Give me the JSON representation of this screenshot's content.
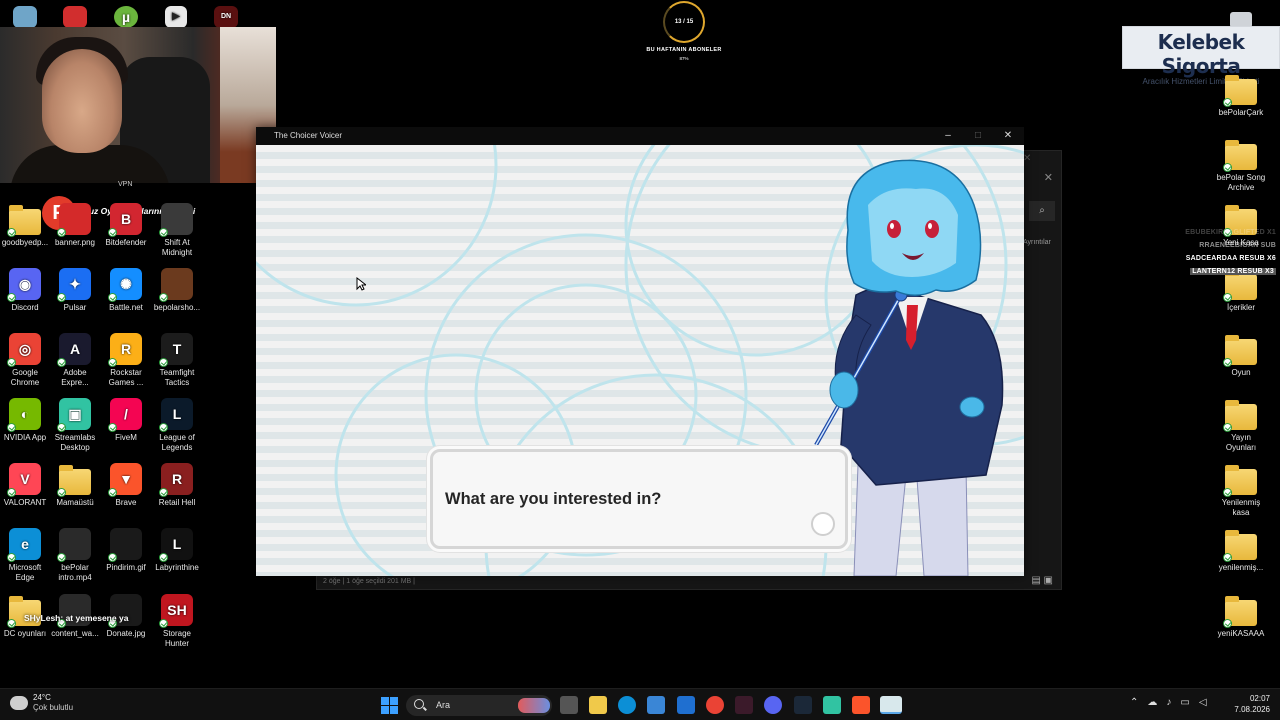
{
  "desktop": {
    "icons": [
      {
        "label": "goodbyedp...",
        "color": "#f0c94a",
        "folder": true
      },
      {
        "label": "banner.png",
        "color": "#d42a2a"
      },
      {
        "label": "Bitdefender",
        "color": "#d22630",
        "glyph": "B"
      },
      {
        "label": "Shift At Midnight",
        "color": "#3a3a3a"
      },
      {
        "label": "Discord",
        "color": "#5865f2",
        "glyph": "◉"
      },
      {
        "label": "Pulsar",
        "color": "#1b6ef3",
        "glyph": "✦"
      },
      {
        "label": "Battle.net",
        "color": "#148eff",
        "glyph": "✺"
      },
      {
        "label": "bepolarsho...",
        "color": "#6b3a1e"
      },
      {
        "label": "Google Chrome",
        "color": "#ea4335",
        "glyph": "◎"
      },
      {
        "label": "Adobe Expre...",
        "color": "#1a1a2e",
        "glyph": "A"
      },
      {
        "label": "Rockstar Games ...",
        "color": "#fcaf17",
        "glyph": "R"
      },
      {
        "label": "Teamfight Tactics",
        "color": "#1c1c1c",
        "glyph": "T"
      },
      {
        "label": "NVIDIA App",
        "color": "#76b900",
        "glyph": "◐"
      },
      {
        "label": "Streamlabs Desktop",
        "color": "#31c3a2",
        "glyph": "▣"
      },
      {
        "label": "FiveM",
        "color": "#f40552",
        "glyph": "/"
      },
      {
        "label": "League of Legends",
        "color": "#0b1a2a",
        "glyph": "L"
      },
      {
        "label": "VALORANT",
        "color": "#ff4655",
        "glyph": "V"
      },
      {
        "label": "Mamaüstü",
        "color": "#f0c94a",
        "folder": true
      },
      {
        "label": "Brave",
        "color": "#fb542b",
        "glyph": "▼"
      },
      {
        "label": "Retail Hell",
        "color": "#8a1f1f",
        "glyph": "R"
      },
      {
        "label": "Microsoft Edge",
        "color": "#0c8fd6",
        "glyph": "e"
      },
      {
        "label": "bePolar intro.mp4",
        "color": "#2a2a2a"
      },
      {
        "label": "Pindirim.gif",
        "color": "#1a1a1a"
      },
      {
        "label": "Labyrinthine",
        "color": "#111111",
        "glyph": "L"
      },
      {
        "label": "DC oyunları",
        "color": "#f0c94a",
        "folder": true
      },
      {
        "label": "content_wa...",
        "color": "#2a2a2a"
      },
      {
        "label": "Donate.jpg",
        "color": "#1a1a1a"
      },
      {
        "label": "Storage Hunter",
        "color": "#c0161f",
        "glyph": "SH"
      }
    ],
    "right_icons": [
      {
        "label": "bePolarÇark"
      },
      {
        "label": "bePolar Song Archive"
      },
      {
        "label": "Yeni Kasa"
      },
      {
        "label": "İçerikler"
      },
      {
        "label": "Oyun"
      },
      {
        "label": "Yayın Oyunları"
      },
      {
        "label": "Yenilenmiş kasa"
      },
      {
        "label": "yenilenmiş..."
      },
      {
        "label": "yeniKASAAA"
      }
    ],
    "overlay_labels": {
      "vpn": "VPN",
      "promo": "Ucuz Oyun Kodlarının Adresi",
      "chat": "SHyLesh: at yemesene ya"
    }
  },
  "subscriber_widget": {
    "count": "13 / 15",
    "title": "BU HAFTANIN ABONELER",
    "percent": "87%",
    "progress": 0.87
  },
  "sponsor": {
    "name": "Kelebek Sigorta",
    "tagline": "Aracılık Hizmetleri Limited Şirketi"
  },
  "resubs": [
    "EBUBEKIRSAGLIFTED X1",
    "RRAENEEBIGAN SUB",
    "SADCEARDAA RESUB X6",
    "LANTERN12 RESUB X3"
  ],
  "explorer": {
    "search_icon": "search-icon",
    "properties": "Ayrıntılar",
    "status": "2 öğe  |  1 öğe seçildi 201 MB  |"
  },
  "game": {
    "window_title": "The Choicer Voicer",
    "dialog_text": "What are you interested in?"
  },
  "taskbar": {
    "temperature": "24°C",
    "weather": "Çok bulutlu",
    "search_placeholder": "Ara",
    "time": "02:07",
    "date": "7.08.2026"
  }
}
